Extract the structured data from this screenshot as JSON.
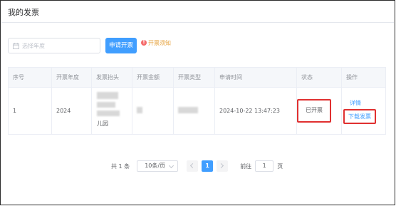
{
  "page": {
    "title": "我的发票"
  },
  "filter": {
    "year_placeholder": "选择年度",
    "apply_button": "申请开票",
    "notice_link": "开票须知"
  },
  "table": {
    "columns": [
      "序号",
      "开票年度",
      "发票抬头",
      "开票金额",
      "开票类型",
      "申请时间",
      "状态",
      "操作"
    ],
    "rows": [
      {
        "index": "1",
        "year": "2024",
        "title_visible_tail": "儿园",
        "amount": "",
        "type": "",
        "apply_time": "2024-10-22 13:47:23",
        "status": "已开票",
        "actions": {
          "detail": "详情",
          "download": "下载发票"
        }
      }
    ]
  },
  "pagination": {
    "total": "共 1 条",
    "page_size": "10条/页",
    "current_page": "1",
    "goto_label": "前往",
    "goto_value": "1",
    "page_suffix": "页"
  },
  "colors": {
    "primary": "#409eff",
    "highlight_box": "#e03030",
    "notice": "#e6a23c"
  }
}
